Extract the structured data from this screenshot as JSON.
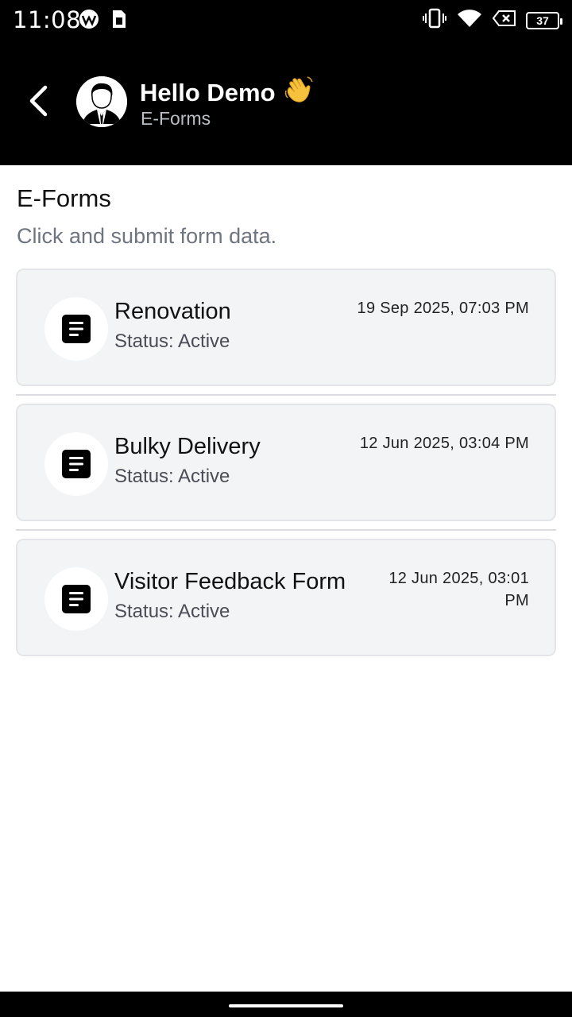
{
  "status_bar": {
    "time": "11:08",
    "battery_level": "37",
    "icons": [
      "app-notification-icon",
      "sim-card-icon",
      "vibrate-icon",
      "wifi-icon",
      "no-sim-icon",
      "battery-icon"
    ]
  },
  "header": {
    "greeting": "Hello Demo",
    "wave_emoji": "👋",
    "subtitle": "E-Forms"
  },
  "page": {
    "title": "E-Forms",
    "description": "Click and submit form data."
  },
  "forms": [
    {
      "title": "Renovation",
      "status": "Status: Active",
      "date": "19 Sep 2025, 07:03 PM"
    },
    {
      "title": "Bulky Delivery",
      "status": "Status: Active",
      "date": "12 Jun 2025, 03:04 PM"
    },
    {
      "title": "Visitor Feedback Form",
      "status": "Status: Active",
      "date": "12 Jun 2025, 03:01 PM"
    }
  ],
  "colors": {
    "header_bg": "#000000",
    "card_bg": "#f3f4f6",
    "muted_text": "#6e7480"
  }
}
